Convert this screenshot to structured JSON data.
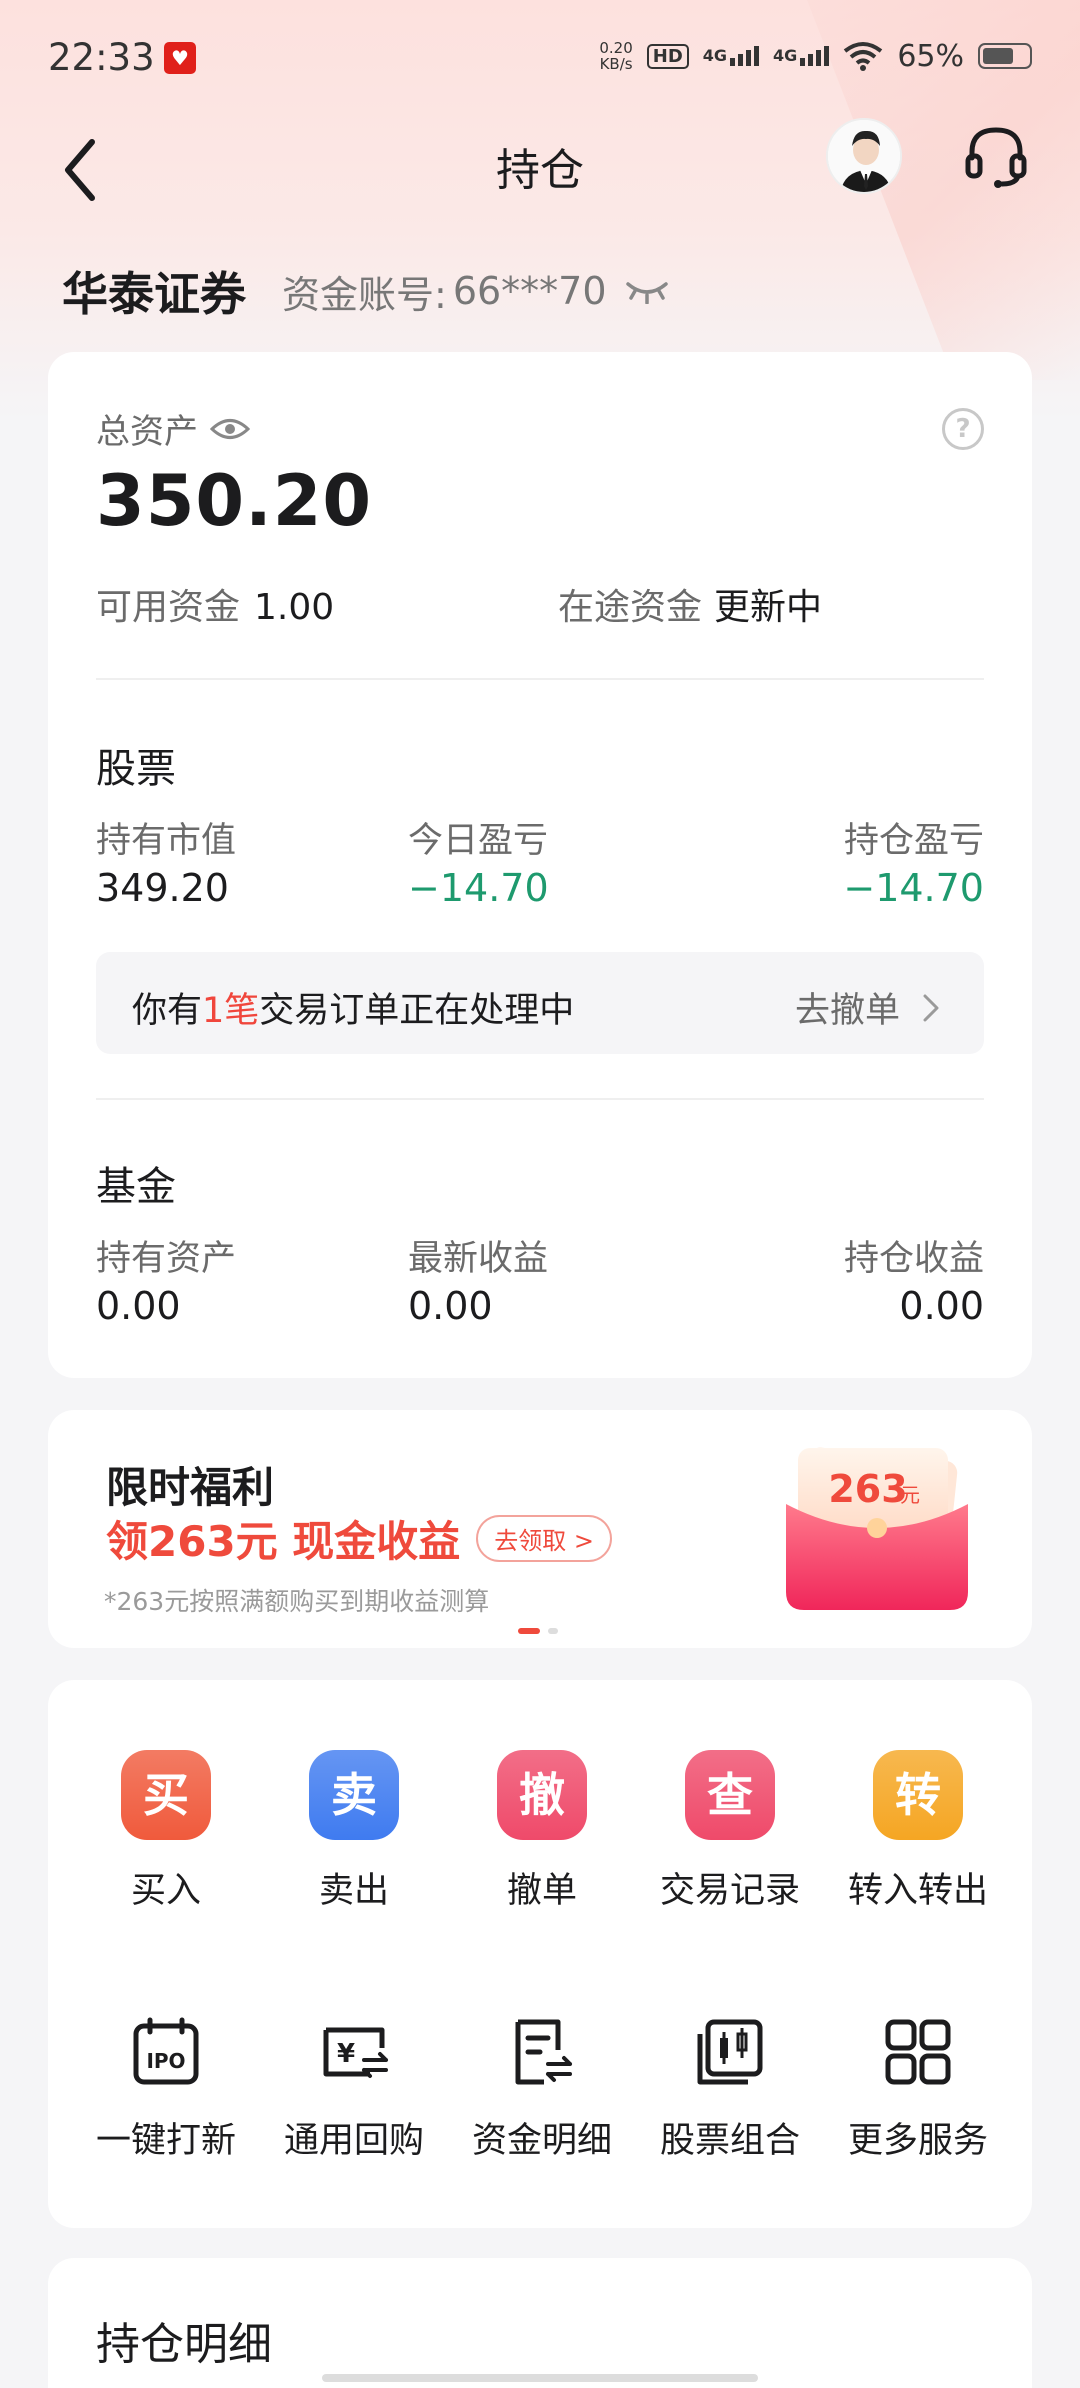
{
  "status_bar": {
    "time": "22:33",
    "net_speed_value": "0.20",
    "net_speed_unit": "KB/s",
    "hd_label": "HD",
    "net1": "4G",
    "net2": "4G",
    "battery_text": "65%",
    "battery_level": 0.65
  },
  "header": {
    "title": "持仓",
    "back_icon": "chevron-left-icon",
    "service_icon": "headset-icon"
  },
  "broker": {
    "name": "华泰证券",
    "account_label": "资金账号:",
    "account_no": "66***70"
  },
  "assets": {
    "total_label": "总资产",
    "total_value": "350.20",
    "help_glyph": "?",
    "available_label": "可用资金",
    "available_value": "1.00",
    "in_transit_label": "在途资金",
    "in_transit_value": "更新中"
  },
  "stocks": {
    "title": "股票",
    "market_value_label": "持有市值",
    "market_value": "349.20",
    "today_pl_label": "今日盈亏",
    "today_pl": "−14.70",
    "position_pl_label": "持仓盈亏",
    "position_pl": "−14.70",
    "pending_prefix": "你有",
    "pending_count": "1笔",
    "pending_suffix": "交易订单正在处理中",
    "pending_action": "去撤单"
  },
  "funds": {
    "title": "基金",
    "holding_label": "持有资产",
    "holding_value": "0.00",
    "latest_label": "最新收益",
    "latest_value": "0.00",
    "position_label": "持仓收益",
    "position_value": "0.00"
  },
  "promo": {
    "title": "限时福利",
    "headline": "领263元 现金收益",
    "button": "去领取 >",
    "note": "*263元按照满额购买到期收益测算",
    "redpack_amount": "263",
    "redpack_unit": "元"
  },
  "actions": [
    {
      "glyph": "买",
      "label": "买入",
      "color": "#f05a3c"
    },
    {
      "glyph": "卖",
      "label": "卖出",
      "color": "#3f7bf0"
    },
    {
      "glyph": "撤",
      "label": "撤单",
      "color": "#ef4a6a"
    },
    {
      "glyph": "查",
      "label": "交易记录",
      "color": "#ef4a6a"
    },
    {
      "glyph": "转",
      "label": "转入转出",
      "color": "#f5a623"
    }
  ],
  "services": [
    {
      "icon": "ipo-calendar-icon",
      "label": "一键打新",
      "icon_text": "IPO"
    },
    {
      "icon": "repo-yen-icon",
      "label": "通用回购",
      "icon_text": "¥"
    },
    {
      "icon": "fund-detail-icon",
      "label": "资金明细"
    },
    {
      "icon": "stock-portfolio-icon",
      "label": "股票组合"
    },
    {
      "icon": "grid-more-icon",
      "label": "更多服务"
    }
  ],
  "holdings": {
    "title": "持仓明细"
  }
}
